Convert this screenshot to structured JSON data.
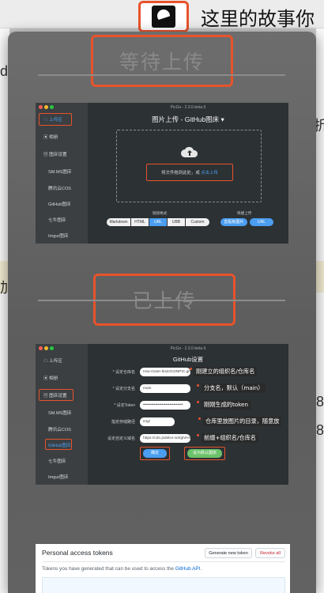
{
  "menubar": {
    "title": "这里的故事你"
  },
  "background": {
    "left_letter": "d",
    "right_letter_1": "折",
    "left_letter_2": "加",
    "right_num_1": "8",
    "right_num_2": "8"
  },
  "sections": {
    "waiting": "等待上传",
    "uploaded": "已上传"
  },
  "picgo_upload": {
    "version": "PicGo - 2.3.0-beta.5",
    "title": "图片上传 - GitHub图床 ▾",
    "sidebar": [
      "上传区",
      "相册",
      "图床设置",
      "SM.MS图床",
      "腾讯云COS",
      "GitHub图床",
      "七牛图床",
      "Imgur图床"
    ],
    "drop_text": "将文件拖到此处，或",
    "drop_link": "点击上传",
    "format_label": "链接格式",
    "formats": [
      "Markdown",
      "HTML",
      "URL",
      "UBB",
      "Custom"
    ],
    "quick_label": "快捷上传",
    "quick_buttons": [
      "剪贴板图片",
      "URL"
    ]
  },
  "picgo_settings": {
    "version": "PicGo - 2.3.0-beta.5",
    "title": "GitHub设置",
    "sidebar": [
      "上传区",
      "相册",
      "图床设置",
      "SM.MS图床",
      "腾讯云COS",
      "GitHub图床",
      "七牛图床",
      "Imgur图床"
    ],
    "fields": [
      {
        "label": "* 设定仓库名",
        "value": "Hsu-Outer-Iksin/CDNPIC.git",
        "note": "刚建立的组织名/仓库名"
      },
      {
        "label": "* 设定分支名",
        "value": "main",
        "note": "分支名，默认（main）"
      },
      {
        "label": "* 设定Token",
        "value": "••••••••••••••••••••••••••••••",
        "note": "刚刚生成的token"
      },
      {
        "label": "指定存储路径",
        "value": "img/",
        "note": "仓库里放图片的目录，随意放"
      },
      {
        "label": "设定自定义域名",
        "value": "https://cdn.jsdelivr.net/gh/Hsu-",
        "note": "前缀+组织名/仓库名"
      }
    ],
    "confirm": "确定",
    "set_default": "设为默认图床"
  },
  "github": {
    "title": "Personal access tokens",
    "generate": "Generate new token",
    "revoke": "Revoke all",
    "desc_prefix": "Tokens you have generated that can be used to access the ",
    "desc_link": "GitHub API",
    "desc_suffix": "."
  },
  "colors": {
    "accent": "#e8532b",
    "picgo_blue": "#4b9ef0",
    "picgo_bg": "#2c3134"
  }
}
